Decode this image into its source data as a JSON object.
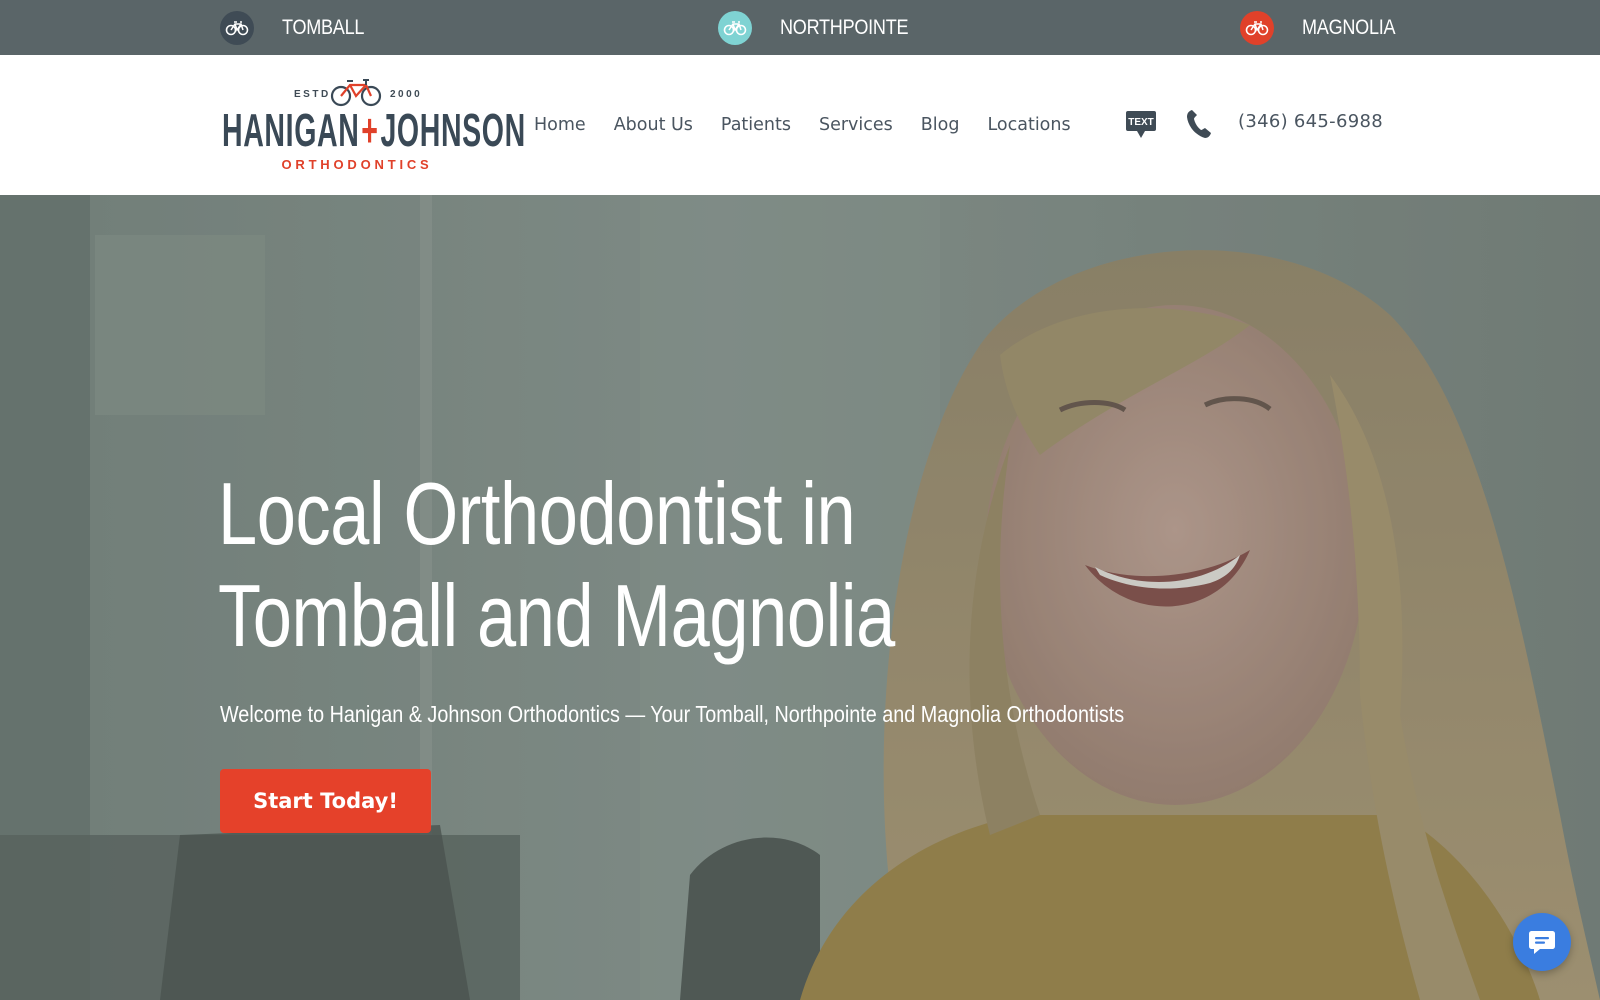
{
  "locations_bar": {
    "items": [
      {
        "label": "TOMBALL",
        "badge_color": "#3f4b55"
      },
      {
        "label": "NORTHPOINTE",
        "badge_color": "#7fd3d3"
      },
      {
        "label": "MAGNOLIA",
        "badge_color": "#e0412a"
      }
    ]
  },
  "logo": {
    "estd": "ESTD",
    "year": "2000",
    "name_left": "HANIGAN",
    "plus": "+",
    "name_right": "JOHNSON",
    "subtitle": "ORTHODONTICS"
  },
  "nav": {
    "items": [
      "Home",
      "About Us",
      "Patients",
      "Services",
      "Blog",
      "Locations"
    ]
  },
  "contact": {
    "text_icon_label": "TEXT",
    "phone": "(346) 645-6988"
  },
  "hero": {
    "title_line1": "Local Orthodontist in",
    "title_line2": "Tomball and Magnolia",
    "subtitle": "Welcome to Hanigan & Johnson Orthodontics — Your Tomball, Northpointe and Magnolia Orthodontists",
    "cta_label": "Start Today!"
  },
  "colors": {
    "top_bar": "#5a6568",
    "brand_dark": "#3a4956",
    "brand_red": "#e0412a",
    "cta": "#e5412a",
    "chat": "#3a7de0"
  }
}
